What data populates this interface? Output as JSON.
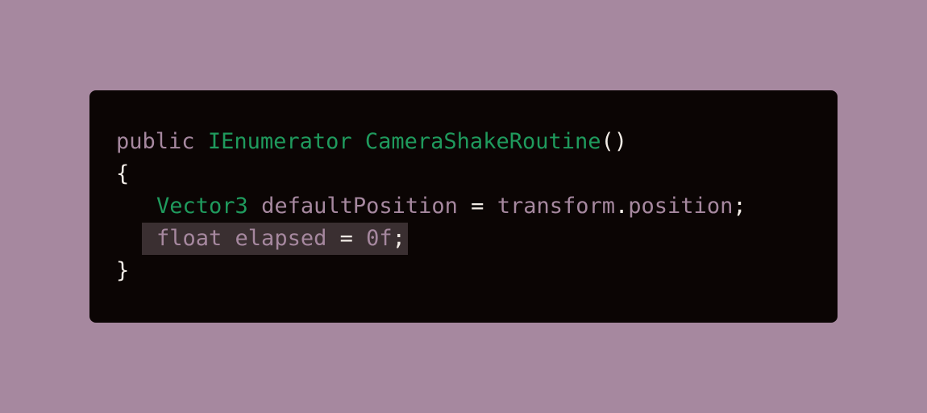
{
  "colors": {
    "background": "#a6889f",
    "card": "#0b0504",
    "keyword": "#a6889f",
    "type": "#1f9a5d",
    "punctuation": "#f2ece6",
    "highlight": "#3a2f31"
  },
  "code": {
    "line1": {
      "kw_public": "public",
      "type_ienumerator": "IEnumerator",
      "fn_name": "CameraShakeRoutine",
      "parens": "()"
    },
    "line2": {
      "open_brace": "{"
    },
    "line3": {
      "type_vector3": "Vector3",
      "var_default_position": "defaultPosition",
      "op_assign": "=",
      "ident_transform": "transform",
      "dot": ".",
      "ident_position": "position",
      "semicolon": ";"
    },
    "line4": {
      "kw_float": "float",
      "var_elapsed": "elapsed",
      "op_assign": "=",
      "num_zero": "0f",
      "semicolon": ";"
    },
    "line5": {
      "close_brace": "}"
    }
  }
}
